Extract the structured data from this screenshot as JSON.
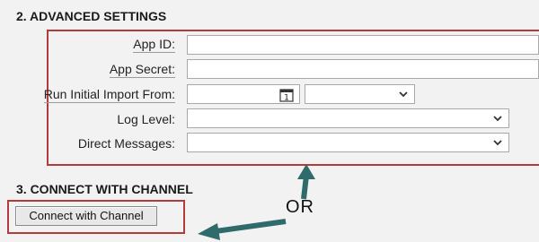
{
  "advanced_settings": {
    "title": "2. ADVANCED SETTINGS",
    "fields": {
      "app_id": {
        "label": "App ID:",
        "value": ""
      },
      "app_secret": {
        "label": "App Secret:",
        "value": ""
      },
      "run_initial_import": {
        "label": "Run Initial Import From:",
        "date_value": "",
        "time_value": "",
        "calendar_day": "1"
      },
      "log_level": {
        "label": "Log Level:",
        "value": ""
      },
      "direct_messages": {
        "label": "Direct Messages:",
        "value": ""
      }
    }
  },
  "connect_section": {
    "title": "3. CONNECT WITH CHANNEL",
    "button_label": "Connect with Channel",
    "or_text": "OR"
  },
  "colors": {
    "highlight": "#b23b3b",
    "arrow": "#2f6b6b"
  }
}
